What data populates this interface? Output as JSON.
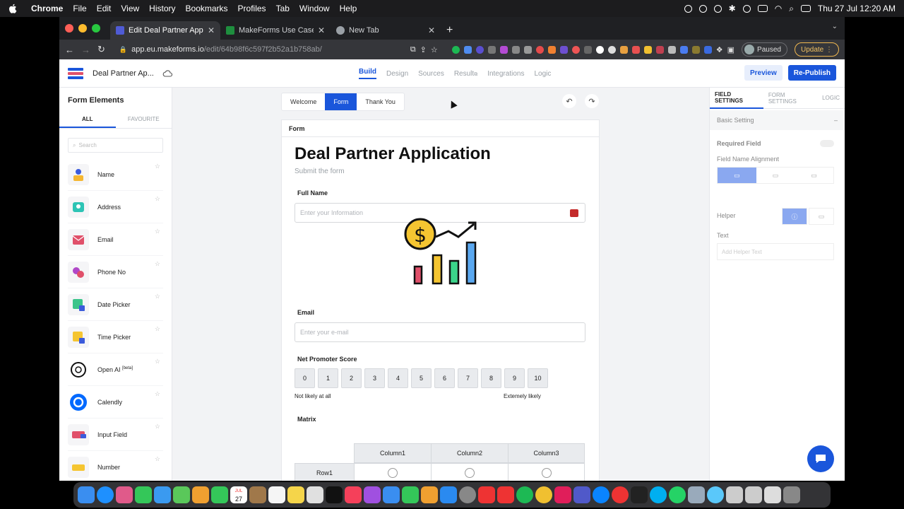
{
  "menubar": {
    "app": "Chrome",
    "items": [
      "File",
      "Edit",
      "View",
      "History",
      "Bookmarks",
      "Profiles",
      "Tab",
      "Window",
      "Help"
    ],
    "clock": "Thu 27 Jul  12:20 AM"
  },
  "browser": {
    "tabs": [
      {
        "title": "Edit Deal Partner Application |",
        "color": "#4f5bd5"
      },
      {
        "title": "MakeForms Use Cases + Exam",
        "color": "#1e8e3e"
      },
      {
        "title": "New Tab",
        "color": "#9aa0a6"
      }
    ],
    "url_host": "app.eu.makeforms.io",
    "url_path": "/edit/64b98f6c597f2b52a1b758ab/",
    "paused_label": "Paused",
    "update_label": "Update"
  },
  "app": {
    "form_name": "Deal Partner Ap...",
    "nav": [
      "Build",
      "Design",
      "Sources",
      "Result",
      "Integrations",
      "Logic"
    ],
    "preview_label": "Preview",
    "republish_label": "Re-Publish"
  },
  "left_panel": {
    "title": "Form Elements",
    "tabs": [
      "ALL",
      "FAVOURITE"
    ],
    "search_placeholder": "Search",
    "elements": [
      {
        "name": "Name",
        "color": "#f5b731"
      },
      {
        "name": "Address",
        "color": "#2dc4b5"
      },
      {
        "name": "Email",
        "color": "#e0506a"
      },
      {
        "name": "Phone No",
        "color": "#b048c8"
      },
      {
        "name": "Date Picker",
        "color": "#3bc48a"
      },
      {
        "name": "Time Picker",
        "color": "#f5c531"
      },
      {
        "name": "Open AI",
        "badge": "[beta]",
        "color": "#111111"
      },
      {
        "name": "Calendly",
        "color": "#0069ff"
      },
      {
        "name": "Input Field",
        "color": "#e0506a"
      },
      {
        "name": "Number",
        "color": "#f5c531"
      }
    ]
  },
  "canvas": {
    "page_tabs": [
      "Welcome",
      "Form",
      "Thank You"
    ],
    "card_header": "Form",
    "form_title": "Deal Partner Application",
    "form_subtitle": "Submit the form",
    "fields": {
      "full_name_label": "Full Name",
      "full_name_placeholder": "Enter your Information",
      "email_label": "Email",
      "email_placeholder": "Enter your e-mail",
      "nps_label": "Net Promoter Score",
      "nps_values": [
        "0",
        "1",
        "2",
        "3",
        "4",
        "5",
        "6",
        "7",
        "8",
        "9",
        "10"
      ],
      "nps_low": "Not likely at all",
      "nps_high": "Extemely likely",
      "matrix_label": "Matrix",
      "matrix_columns": [
        "Column1",
        "Column2",
        "Column3"
      ],
      "matrix_rows": [
        "Row1"
      ]
    }
  },
  "right_panel": {
    "tabs": [
      "FIELD SETTINGS",
      "FORM SETTINGS",
      "LOGIC"
    ],
    "section": "Basic Setting",
    "required_label": "Required Field",
    "alignment_label": "Field Name Alignment",
    "helper_label": "Helper",
    "text_label": "Text",
    "helper_placeholder": "Add Helper Text"
  },
  "dock_calendar_day": "27",
  "dock_calendar_month": "JUL"
}
